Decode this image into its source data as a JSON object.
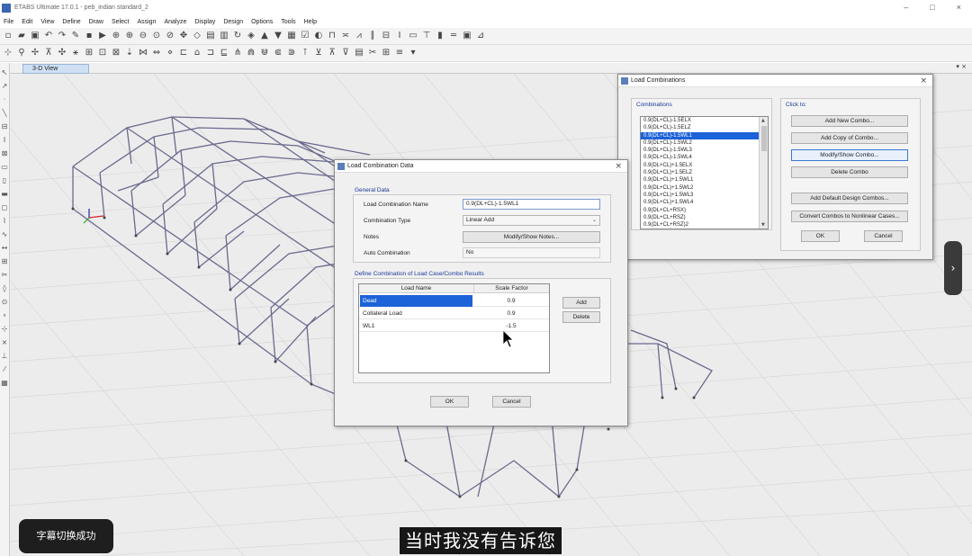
{
  "window": {
    "title": "ETABS Ultimate 17.0.1 - peb_indian standard_2",
    "min_icon": "minimize-icon",
    "max_icon": "maximize-icon",
    "close_icon": "close-icon"
  },
  "menu": [
    "File",
    "Edit",
    "View",
    "Define",
    "Draw",
    "Select",
    "Assign",
    "Analyze",
    "Display",
    "Design",
    "Options",
    "Tools",
    "Help"
  ],
  "view_tab": {
    "label": "3-D View",
    "close_glyph": "▾ ×"
  },
  "load_combinations": {
    "title": "Load Combinations",
    "combinations_label": "Combinations",
    "click_to_label": "Click to:",
    "items": [
      "0.9(DL+CL)-1.5ELX",
      "0.9(DL+CL)-1.5ELZ",
      "0.9(DL+CL)-1.5WL1",
      "0.9(DL+CL)-1.5WL2",
      "0.9(DL+CL)-1.5WL3",
      "0.9(DL+CL)-1.5WL4",
      "0.9(DL+CL)+1.5ELX",
      "0.9(DL+CL)+1.5ELZ",
      "0.9(DL+CL)+1.5WL1",
      "0.9(DL+CL)+1.5WL2",
      "0.9(DL+CL)+1.5WL3",
      "0.9(DL+CL)+1.5WL4",
      "0.9(DL+CL+RSX)",
      "0.9(DL+CL+RSZ)",
      "0.9(DL+CL+RSZ)2"
    ],
    "selected_index": 2,
    "buttons": {
      "add_new": "Add New Combo...",
      "add_copy": "Add Copy of Combo...",
      "modify": "Modify/Show Combo...",
      "delete": "Delete Combo",
      "add_default": "Add Default Design Combos...",
      "convert": "Convert Combos to Nonlinear Cases...",
      "ok": "OK",
      "cancel": "Cancel"
    }
  },
  "load_combination_data": {
    "title": "Load Combination Data",
    "general_data_label": "General Data",
    "name_label": "Load Combination Name",
    "name_value": "0.9(DL+CL)-1.5WL1",
    "type_label": "Combination Type",
    "type_value": "Linear Add",
    "notes_label": "Notes",
    "notes_button": "Modify/Show Notes...",
    "auto_label": "Auto Combination",
    "auto_value": "No",
    "define_label": "Define Combination of Load Case/Combo Results",
    "table": {
      "headers": [
        "Load Name",
        "Scale Factor"
      ],
      "rows": [
        {
          "name": "Dead",
          "factor": "0.9"
        },
        {
          "name": "Collateral Load",
          "factor": "0.9"
        },
        {
          "name": "WL1",
          "factor": "-1.5"
        }
      ]
    },
    "add_button": "Add",
    "delete_button": "Delete",
    "ok_button": "OK",
    "cancel_button": "Cancel"
  },
  "overlay": {
    "toast": "字幕切换成功",
    "subtitle": "当时我没有告诉您",
    "side_arrow": "›"
  }
}
